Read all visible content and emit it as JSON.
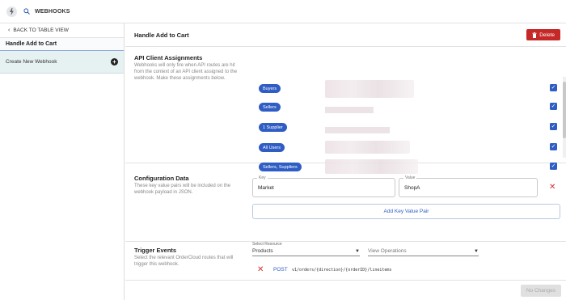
{
  "app": {
    "title": "WEBHOOKS",
    "logo_icon": "oc-logo-icon",
    "search_icon": "search-icon"
  },
  "sidebar": {
    "back_label": "BACK TO TABLE VIEW",
    "active_item": "Handle Add to Cart",
    "create_label": "Create New Webhook"
  },
  "header": {
    "title": "Handle Add to Cart",
    "delete_label": "Delete"
  },
  "api_clients": {
    "title": "API Client Assignments",
    "description": "Webhooks will only fire when API routes are hit from the context of an API client assigned to the webhook. Make these assignments below.",
    "items": [
      {
        "label": "Buyers",
        "checked": true
      },
      {
        "label": "Sellers",
        "checked": true
      },
      {
        "label": "1 Supplier",
        "checked": true
      },
      {
        "label": "All Users",
        "checked": true
      },
      {
        "label": "Sellers, Suppliers",
        "checked": true
      }
    ]
  },
  "config": {
    "title": "Configuration Data",
    "description": "These key value pairs will be included on the webhook payload in JSON.",
    "key_label": "Key",
    "key_value": "Market",
    "value_label": "Value",
    "value_value": "ShopA",
    "add_label": "Add Key Value Pair"
  },
  "triggers": {
    "title": "Trigger Events",
    "description": "Select the relevant OrderCloud routes that will trigger this webhook.",
    "resource_label": "Select Resource",
    "resource_value": "Products",
    "operations_placeholder": "View Operations",
    "route_method": "POST",
    "route_path": "v1/orders/{direction}/{orderID}/lineitems"
  },
  "footer": {
    "no_changes_label": "No Changes"
  },
  "colors": {
    "accent": "#2f5dc4",
    "danger": "#c62828"
  }
}
